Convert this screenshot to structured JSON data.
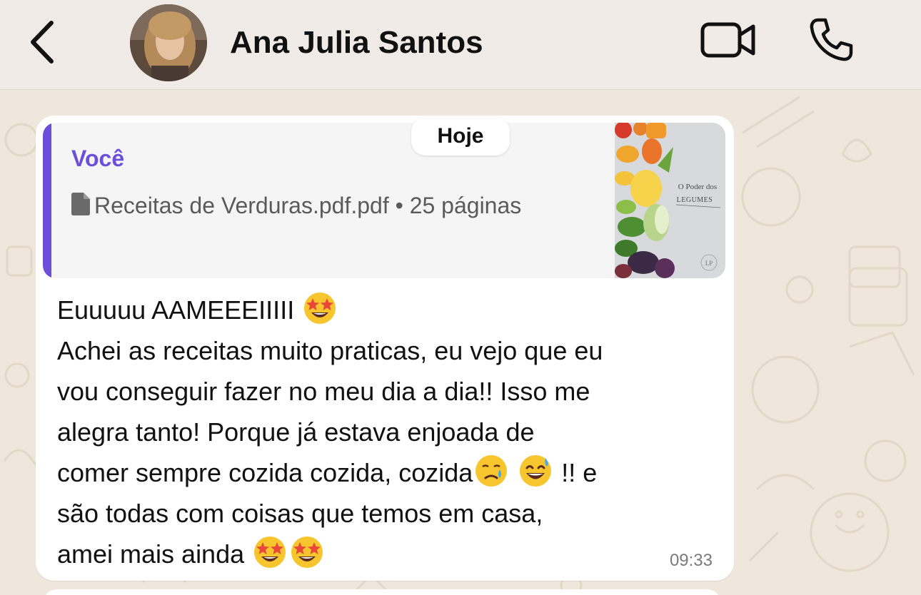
{
  "header": {
    "contact_name": "Ana Julia Santos"
  },
  "chat": {
    "date_separator": "Hoje",
    "message": {
      "quoted": {
        "author": "Você",
        "file_name": "Receitas de Verduras.pdf.pdf",
        "separator": "•",
        "pages": "25 páginas",
        "thumbnail_title_line1": "O Poder dos",
        "thumbnail_title_line2": "LEGUMES",
        "thumbnail_monogram": "LP"
      },
      "lines": [
        "Euuuuu AAMEEEIIIII",
        "Achei as receitas muito praticas, eu vejo que eu",
        "vou conseguir fazer no meu dia a dia!! Isso me",
        "alegra tanto! Porque já estava enjoada de",
        "comer sempre cozida cozida, cozida",
        "!! e",
        "são todas com coisas que temos em casa,",
        "amei mais ainda"
      ],
      "time": "09:33"
    }
  },
  "colors": {
    "header_bg": "#f0ebe6",
    "wallpaper_bg": "#efe7dc",
    "bubble_bg": "#ffffff",
    "quote_accent": "#6b4fdb",
    "quote_bg": "#f5f5f5"
  },
  "icons": {
    "back": "chevron-left-icon",
    "video": "video-camera-icon",
    "call": "phone-icon",
    "document": "document-icon",
    "emojis": [
      "star-struck-emoji",
      "sad-relieved-emoji",
      "grinning-sweat-emoji"
    ]
  }
}
